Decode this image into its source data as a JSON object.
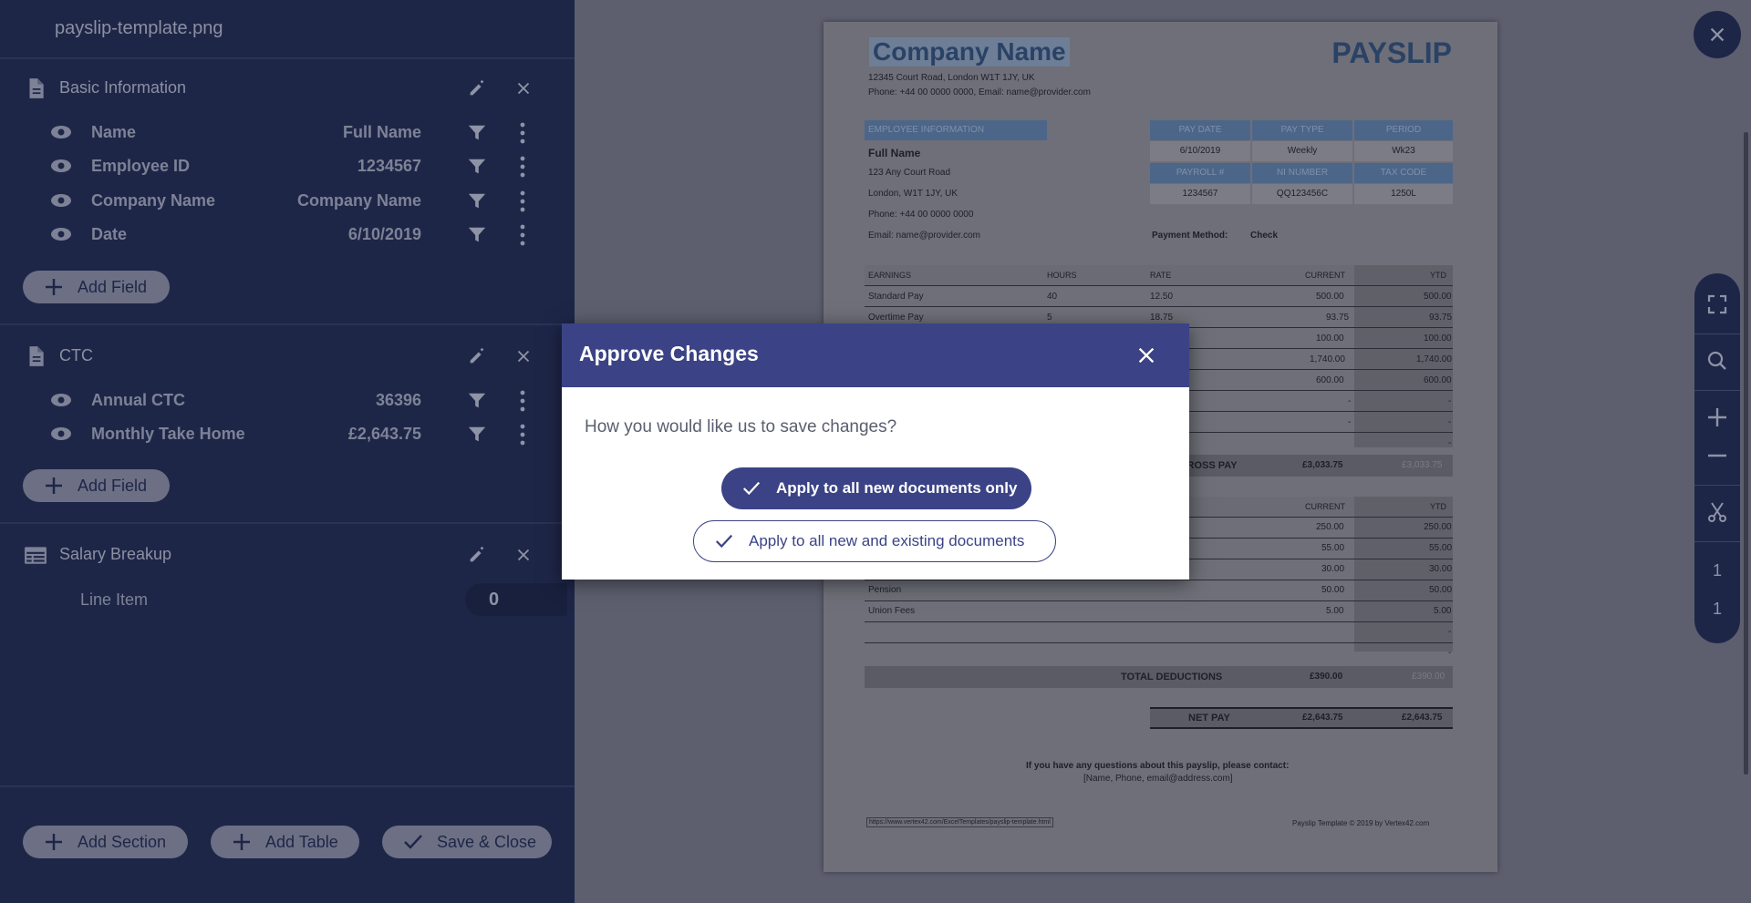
{
  "file_title": "payslip-template.png",
  "sections": [
    {
      "title": "Basic Information",
      "icon": "document-icon",
      "fields": [
        {
          "name": "Name",
          "value": "Full Name"
        },
        {
          "name": "Employee ID",
          "value": "1234567"
        },
        {
          "name": "Company Name",
          "value": "Company Name"
        },
        {
          "name": "Date",
          "value": "6/10/2019"
        }
      ],
      "add_label": "Add Field"
    },
    {
      "title": "CTC",
      "icon": "document-icon",
      "fields": [
        {
          "name": "Annual CTC",
          "value": "36396"
        },
        {
          "name": "Monthly Take Home",
          "value": "£2,643.75"
        }
      ],
      "add_label": "Add Field"
    },
    {
      "title": "Salary Breakup",
      "icon": "table-icon",
      "line_item_label": "Line Item",
      "line_item_value": "0"
    }
  ],
  "footer": {
    "add_section": "Add Section",
    "add_table": "Add Table",
    "save_close": "Save & Close"
  },
  "modal": {
    "title": "Approve Changes",
    "question": "How you would like us to save changes?",
    "option_new": "Apply to all new documents only",
    "option_all": "Apply to all new and existing documents"
  },
  "toolbar": {
    "page_current": "1",
    "page_total": "1"
  },
  "document": {
    "company_name": "Company Name",
    "heading": "PAYSLIP",
    "address": "12345 Court Road, London W1T 1JY, UK",
    "contact": "Phone: +44 00 0000 0000, Email: name@provider.com",
    "emp_info_header": "EMPLOYEE INFORMATION",
    "emp_name": "Full Name",
    "emp_addr1": "123 Any Court Road",
    "emp_addr2": "London, W1T 1JY, UK",
    "emp_phone": "Phone: +44 00 0000 0000",
    "emp_email": "Email: name@provider.com",
    "pay_date_h": "PAY DATE",
    "pay_type_h": "PAY TYPE",
    "period_h": "PERIOD",
    "pay_date": "6/10/2019",
    "pay_type": "Weekly",
    "period": "Wk23",
    "payroll_h": "PAYROLL #",
    "ni_h": "NI NUMBER",
    "tax_h": "TAX CODE",
    "payroll": "1234567",
    "ni": "QQ123456C",
    "tax": "1250L",
    "payment_method_label": "Payment Method:",
    "payment_method": "Check",
    "earn_h": "EARNINGS",
    "hours_h": "HOURS",
    "rate_h": "RATE",
    "current_h": "CURRENT",
    "ytd_h": "YTD",
    "row1": {
      "name": "Standard Pay",
      "hours": "40",
      "rate": "12.50",
      "current": "500.00",
      "ytd": "500.00"
    },
    "row2": {
      "name": "Overtime Pay",
      "hours": "5",
      "rate": "18.75",
      "current": "93.75",
      "ytd": "93.75"
    },
    "row3": {
      "current": "100.00",
      "ytd": "100.00"
    },
    "row4": {
      "current": "1,740.00",
      "ytd": "1,740.00"
    },
    "row5": {
      "current": "600.00",
      "ytd": "600.00"
    },
    "dash": "-",
    "gross_label": "GROSS PAY",
    "gross_current": "£3,033.75",
    "gross_ytd": "£3,033.75",
    "ded_current_h": "CURRENT",
    "ded_ytd_h": "YTD",
    "d1": {
      "current": "250.00",
      "ytd": "250.00"
    },
    "d2": {
      "current": "55.00",
      "ytd": "55.00"
    },
    "d3": {
      "current": "30.00",
      "ytd": "30.00"
    },
    "d4": {
      "name": "Pension",
      "current": "50.00",
      "ytd": "50.00"
    },
    "d5": {
      "name": "Union Fees",
      "current": "5.00",
      "ytd": "5.00"
    },
    "total_ded_label": "TOTAL DEDUCTIONS",
    "total_ded_current": "£390.00",
    "total_ded_ytd": "£390.00",
    "net_label": "NET PAY",
    "net_current": "£2,643.75",
    "net_ytd": "£2,643.75",
    "questions_line1": "If you have any questions about this payslip, please contact:",
    "questions_line2": "[Name, Phone, email@address.com]",
    "footer_link": "https://www.vertex42.com/ExcelTemplates/payslip-template.html",
    "footer_copy": "Payslip Template © 2019 by Vertex42.com"
  },
  "colors": {
    "panel": "#1e2648",
    "modal_header": "#3b4386",
    "pill": "#6d7084"
  }
}
